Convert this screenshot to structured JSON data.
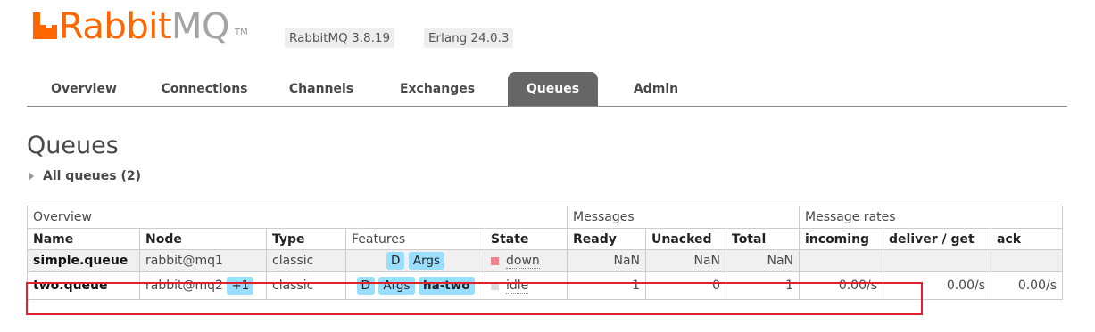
{
  "header": {
    "logo_primary": "Rabbit",
    "logo_secondary": "MQ",
    "logo_tm": "TM",
    "version_rabbitmq": "RabbitMQ 3.8.19",
    "version_erlang": "Erlang 24.0.3"
  },
  "nav": {
    "tabs": [
      {
        "label": "Overview",
        "active": false
      },
      {
        "label": "Connections",
        "active": false
      },
      {
        "label": "Channels",
        "active": false
      },
      {
        "label": "Exchanges",
        "active": false
      },
      {
        "label": "Queues",
        "active": true
      },
      {
        "label": "Admin",
        "active": false
      }
    ]
  },
  "page": {
    "title": "Queues",
    "section_toggle": "All queues (2)"
  },
  "table": {
    "groups": [
      "Overview",
      "Messages",
      "Message rates"
    ],
    "columns": [
      "Name",
      "Node",
      "Type",
      "Features",
      "State",
      "Ready",
      "Unacked",
      "Total",
      "incoming",
      "deliver / get",
      "ack"
    ],
    "rows": [
      {
        "name": "simple.queue",
        "node": "rabbit@mq1",
        "node_extra": "",
        "type": "classic",
        "features": [
          "D",
          "Args"
        ],
        "state": "down",
        "state_color": "#f0828f",
        "ready": "NaN",
        "unacked": "NaN",
        "total": "NaN",
        "incoming": "",
        "deliver_get": "",
        "ack": ""
      },
      {
        "name": "two.queue",
        "node": "rabbit@mq2",
        "node_extra": "+1",
        "type": "classic",
        "features": [
          "D",
          "Args"
        ],
        "policy": "ha-two",
        "state": "idle",
        "state_color": "#dddddd",
        "ready": "1",
        "unacked": "0",
        "total": "1",
        "incoming": "0.00/s",
        "deliver_get": "0.00/s",
        "ack": "0.00/s"
      }
    ]
  },
  "colors": {
    "brand": "#ff6600",
    "active_tab": "#666666",
    "tag": "#99ddff",
    "highlight_border": "#e0202c"
  }
}
